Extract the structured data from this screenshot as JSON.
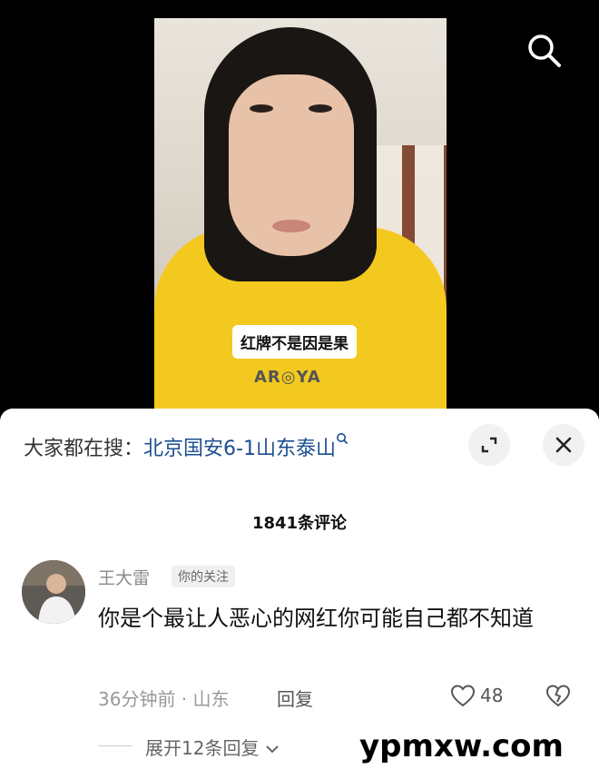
{
  "video": {
    "caption": "红牌不是因是果",
    "shirt_text": "AR◎YA"
  },
  "hot_search": {
    "prefix": "大家都在搜：",
    "term": "北京国安6-1山东泰山"
  },
  "comments": {
    "count_label": "1841条评论",
    "items": [
      {
        "username": "王大雷",
        "badge": "你的关注",
        "text": "你是个最让人恶心的网红你可能自己都不知道",
        "meta": "36分钟前 · 山东",
        "reply_label": "回复",
        "likes": "48",
        "expand_label": "展开12条回复"
      }
    ]
  },
  "watermark": "ypmxw.com",
  "icons": [
    "search-icon",
    "expand-icon",
    "close-icon",
    "heart-icon",
    "dislike-heart-icon",
    "chevron-down-icon"
  ]
}
